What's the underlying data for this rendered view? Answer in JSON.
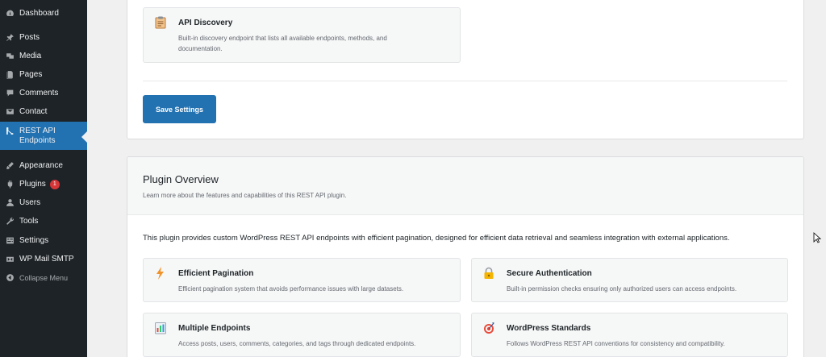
{
  "sidebar": {
    "items": [
      {
        "label": "Dashboard",
        "icon": "dashboard-icon"
      },
      {
        "label": "Posts",
        "icon": "pin-icon"
      },
      {
        "label": "Media",
        "icon": "media-icon"
      },
      {
        "label": "Pages",
        "icon": "pages-icon"
      },
      {
        "label": "Comments",
        "icon": "comment-icon"
      },
      {
        "label": "Contact",
        "icon": "mail-icon"
      },
      {
        "label": "REST API Endpoints",
        "icon": "endpoints-icon"
      },
      {
        "label": "Appearance",
        "icon": "brush-icon"
      },
      {
        "label": "Plugins",
        "icon": "plugin-icon",
        "badge": "1"
      },
      {
        "label": "Users",
        "icon": "users-icon"
      },
      {
        "label": "Tools",
        "icon": "wrench-icon"
      },
      {
        "label": "Settings",
        "icon": "settings-icon"
      },
      {
        "label": "WP Mail SMTP",
        "icon": "smtp-icon"
      },
      {
        "label": "Collapse Menu",
        "icon": "collapse-icon"
      }
    ]
  },
  "settings_card": {
    "api_discovery": {
      "title": "API Discovery",
      "desc_line1": "Built-in discovery endpoint that lists all available endpoints, methods, and",
      "desc_line2": "documentation.",
      "icon": "clipboard-icon"
    },
    "save_label": "Save Settings"
  },
  "overview": {
    "title": "Plugin Overview",
    "subtitle": "Learn more about the features and capabilities of this REST API plugin.",
    "intro": "This plugin provides custom WordPress REST API endpoints with efficient pagination, designed for efficient data retrieval and seamless integration with external applications.",
    "features": [
      {
        "title": "Efficient Pagination",
        "desc": "Efficient pagination system that avoids performance issues with large datasets.",
        "icon": "lightning-icon"
      },
      {
        "title": "Secure Authentication",
        "desc": "Built-in permission checks ensuring only authorized users can access endpoints.",
        "icon": "lock-icon"
      },
      {
        "title": "Multiple Endpoints",
        "desc": "Access posts, users, comments, categories, and tags through dedicated endpoints.",
        "icon": "bar-chart-icon"
      },
      {
        "title": "WordPress Standards",
        "desc": "Follows WordPress REST API conventions for consistency and compatibility.",
        "icon": "target-icon"
      }
    ]
  },
  "colors": {
    "sidebar_bg": "#1d2327",
    "accent": "#2271b1",
    "badge": "#d63638"
  }
}
